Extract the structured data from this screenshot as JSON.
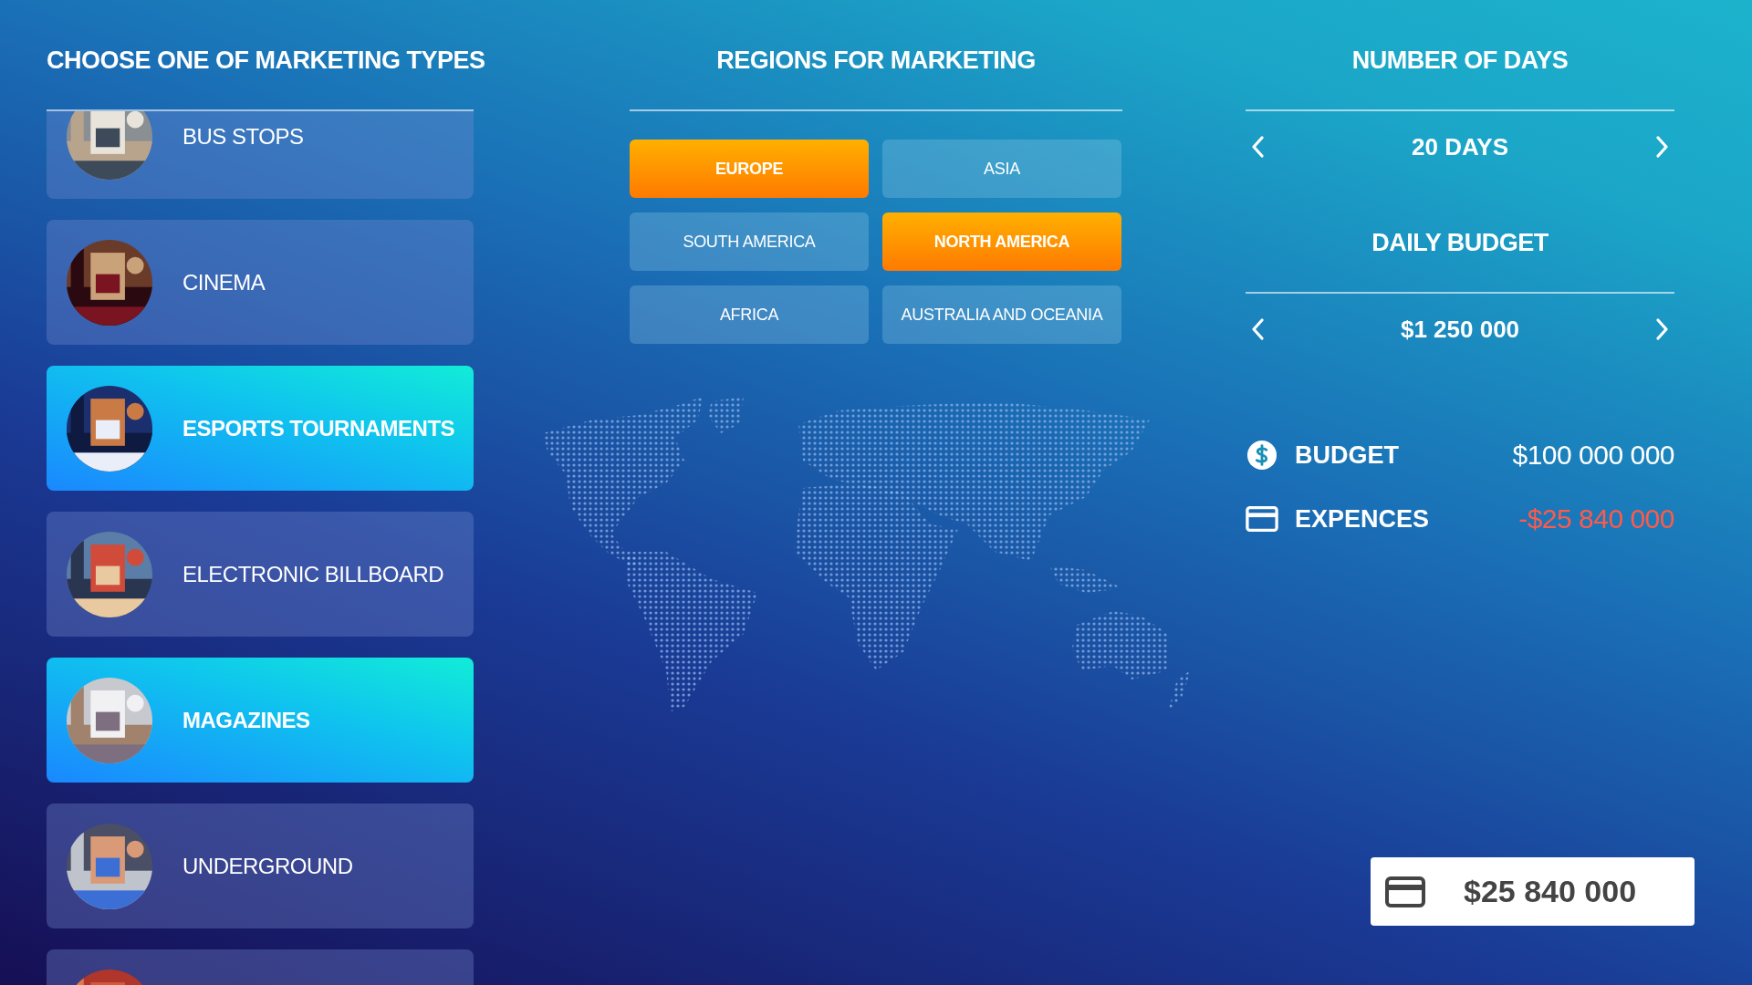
{
  "marketing": {
    "title": "CHOOSE ONE OF MARKETING TYPES",
    "items": [
      {
        "label": "BUS STOPS",
        "selected": false
      },
      {
        "label": "CINEMA",
        "selected": false
      },
      {
        "label": "ESPORTS TOURNAMENTS",
        "selected": true
      },
      {
        "label": "ELECTRONIC BILLBOARD",
        "selected": false
      },
      {
        "label": "MAGAZINES",
        "selected": true
      },
      {
        "label": "UNDERGROUND",
        "selected": false
      },
      {
        "selected": false
      }
    ]
  },
  "regions": {
    "title": "REGIONS FOR MARKETING",
    "options": [
      {
        "label": "EUROPE",
        "selected": true
      },
      {
        "label": "ASIA",
        "selected": false
      },
      {
        "label": "SOUTH AMERICA",
        "selected": false
      },
      {
        "label": "NORTH AMERICA",
        "selected": true
      },
      {
        "label": "AFRICA",
        "selected": false
      },
      {
        "label": "AUSTRALIA AND OCEANIA",
        "selected": false
      }
    ]
  },
  "days": {
    "title": "NUMBER OF DAYS",
    "value": "20 DAYS"
  },
  "daily_budget": {
    "title": "DAILY BUDGET",
    "value": "$1 250 000"
  },
  "summary": [
    {
      "kind": "budget",
      "label": "BUDGET",
      "value": "$100 000 000"
    },
    {
      "kind": "expense",
      "label": "EXPENCES",
      "value": "-$25 840 000"
    }
  ],
  "total_button": {
    "label": "$25 840 000"
  }
}
